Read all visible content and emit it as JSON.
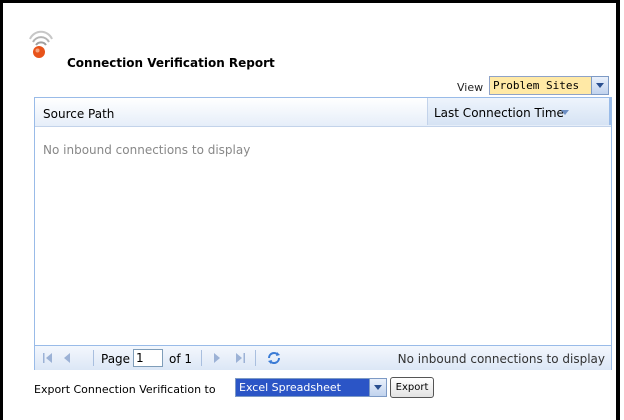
{
  "header": {
    "title": "Connection Verification Report"
  },
  "view": {
    "label": "View",
    "selected": "Problem Sites"
  },
  "grid": {
    "columns": [
      "Source Path",
      "Last Connection Time"
    ],
    "empty_message": "No inbound connections to display"
  },
  "pager": {
    "page_label": "Page",
    "page_value": "1",
    "of_label": "of 1",
    "status": "No inbound connections to display"
  },
  "export": {
    "label": "Export Connection Verification to",
    "selected": "Excel Spreadsheet",
    "button_label": "Export"
  },
  "colors": {
    "grid_border": "#99bbe8",
    "view_select_bg": "#ffe9a6",
    "export_select_bg": "#2b55c6",
    "logo_orange": "#e8531a"
  },
  "icons": [
    "signal-logo-icon",
    "first-page-icon",
    "prev-page-icon",
    "next-page-icon",
    "last-page-icon",
    "refresh-icon",
    "chevron-down-icon",
    "sort-desc-icon"
  ]
}
